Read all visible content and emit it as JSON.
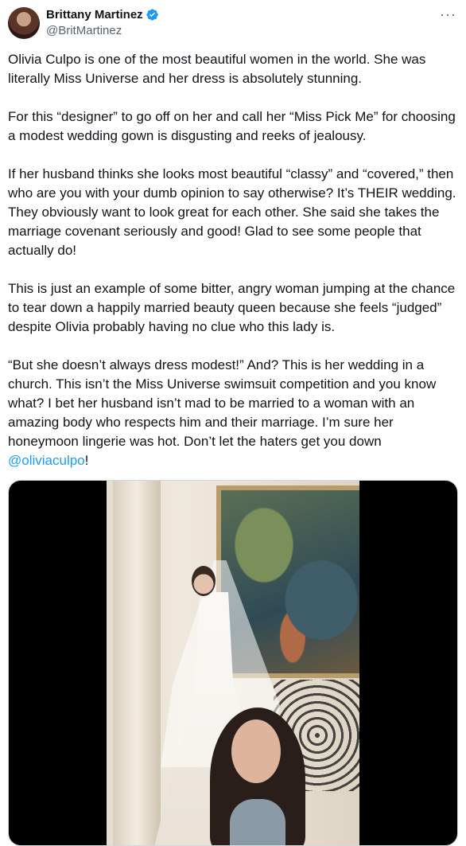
{
  "author": {
    "display_name": "Brittany Martinez",
    "handle": "@BritMartinez",
    "avatar_icon": "avatar-photo",
    "verified_icon": "verified-badge-icon",
    "verified_color": "#1d9bf0"
  },
  "menu": {
    "more_label": "···"
  },
  "tweet": {
    "paragraphs": [
      "Olivia Culpo is one of the most beautiful women in the world. She was literally Miss Universe and her dress is absolutely stunning.",
      "For this “designer” to go off on her and call her “Miss Pick Me” for choosing a modest wedding gown is disgusting and reeks of jealousy.",
      "If her husband thinks she looks most beautiful “classy” and “covered,” then who are you with your dumb opinion to say otherwise? It’s THEIR wedding. They obviously want to look great for each other. She said she takes the marriage covenant seriously and good! Glad to see some people that actually do!",
      "This is just an example of some bitter, angry woman jumping at the chance to tear down a happily married beauty queen because she feels “judged” despite Olivia probably having no clue who this lady is."
    ],
    "last_paragraph": "“But she doesn’t always dress modest!” And? This is her wedding in a church. This isn’t the Miss Universe swimsuit competition and you know what? I bet her husband isn’t mad to be married to a woman with an amazing body who respects him and their marriage. I’m sure her honeymoon lingerie was hot. Don’t let the haters get you down ",
    "mention": "@oliviaculpo",
    "trailing": "!"
  },
  "colors": {
    "text": "#0f1419",
    "secondary": "#536471",
    "link": "#1d9bf0"
  }
}
